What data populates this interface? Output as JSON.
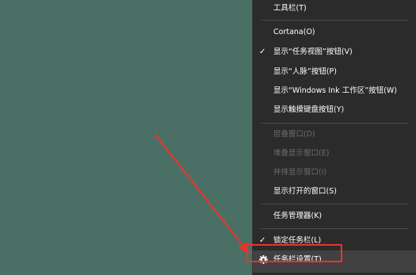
{
  "menu": {
    "items": [
      {
        "label": "工具栏(T)",
        "checked": false,
        "disabled": false
      },
      {
        "label": "Cortana(O)",
        "checked": false,
        "disabled": false
      },
      {
        "label": "显示“任务视图”按钮(V)",
        "checked": true,
        "disabled": false
      },
      {
        "label": "显示“人脉”按钮(P)",
        "checked": false,
        "disabled": false
      },
      {
        "label": "显示“Windows Ink 工作区”按钮(W)",
        "checked": false,
        "disabled": false
      },
      {
        "label": "显示触摸键盘按钮(Y)",
        "checked": false,
        "disabled": false
      },
      {
        "label": "层叠窗口(D)",
        "checked": false,
        "disabled": true
      },
      {
        "label": "堆叠显示窗口(E)",
        "checked": false,
        "disabled": true
      },
      {
        "label": "并排显示窗口(I)",
        "checked": false,
        "disabled": true
      },
      {
        "label": "显示打开的窗口(S)",
        "checked": false,
        "disabled": false
      },
      {
        "label": "任务管理器(K)",
        "checked": false,
        "disabled": false
      },
      {
        "label": "锁定任务栏(L)",
        "checked": true,
        "disabled": false
      },
      {
        "label": "任务栏设置(T)",
        "checked": false,
        "disabled": false,
        "icon": "gear-icon",
        "highlighted": true
      }
    ],
    "check_glyph": "✓"
  },
  "colors": {
    "desktop": "#4a7066",
    "menu_background": "#2b2b2b",
    "menu_text": "#ffffff",
    "disabled_text": "#6d6d6d",
    "annotation_red": "#e8352c"
  }
}
